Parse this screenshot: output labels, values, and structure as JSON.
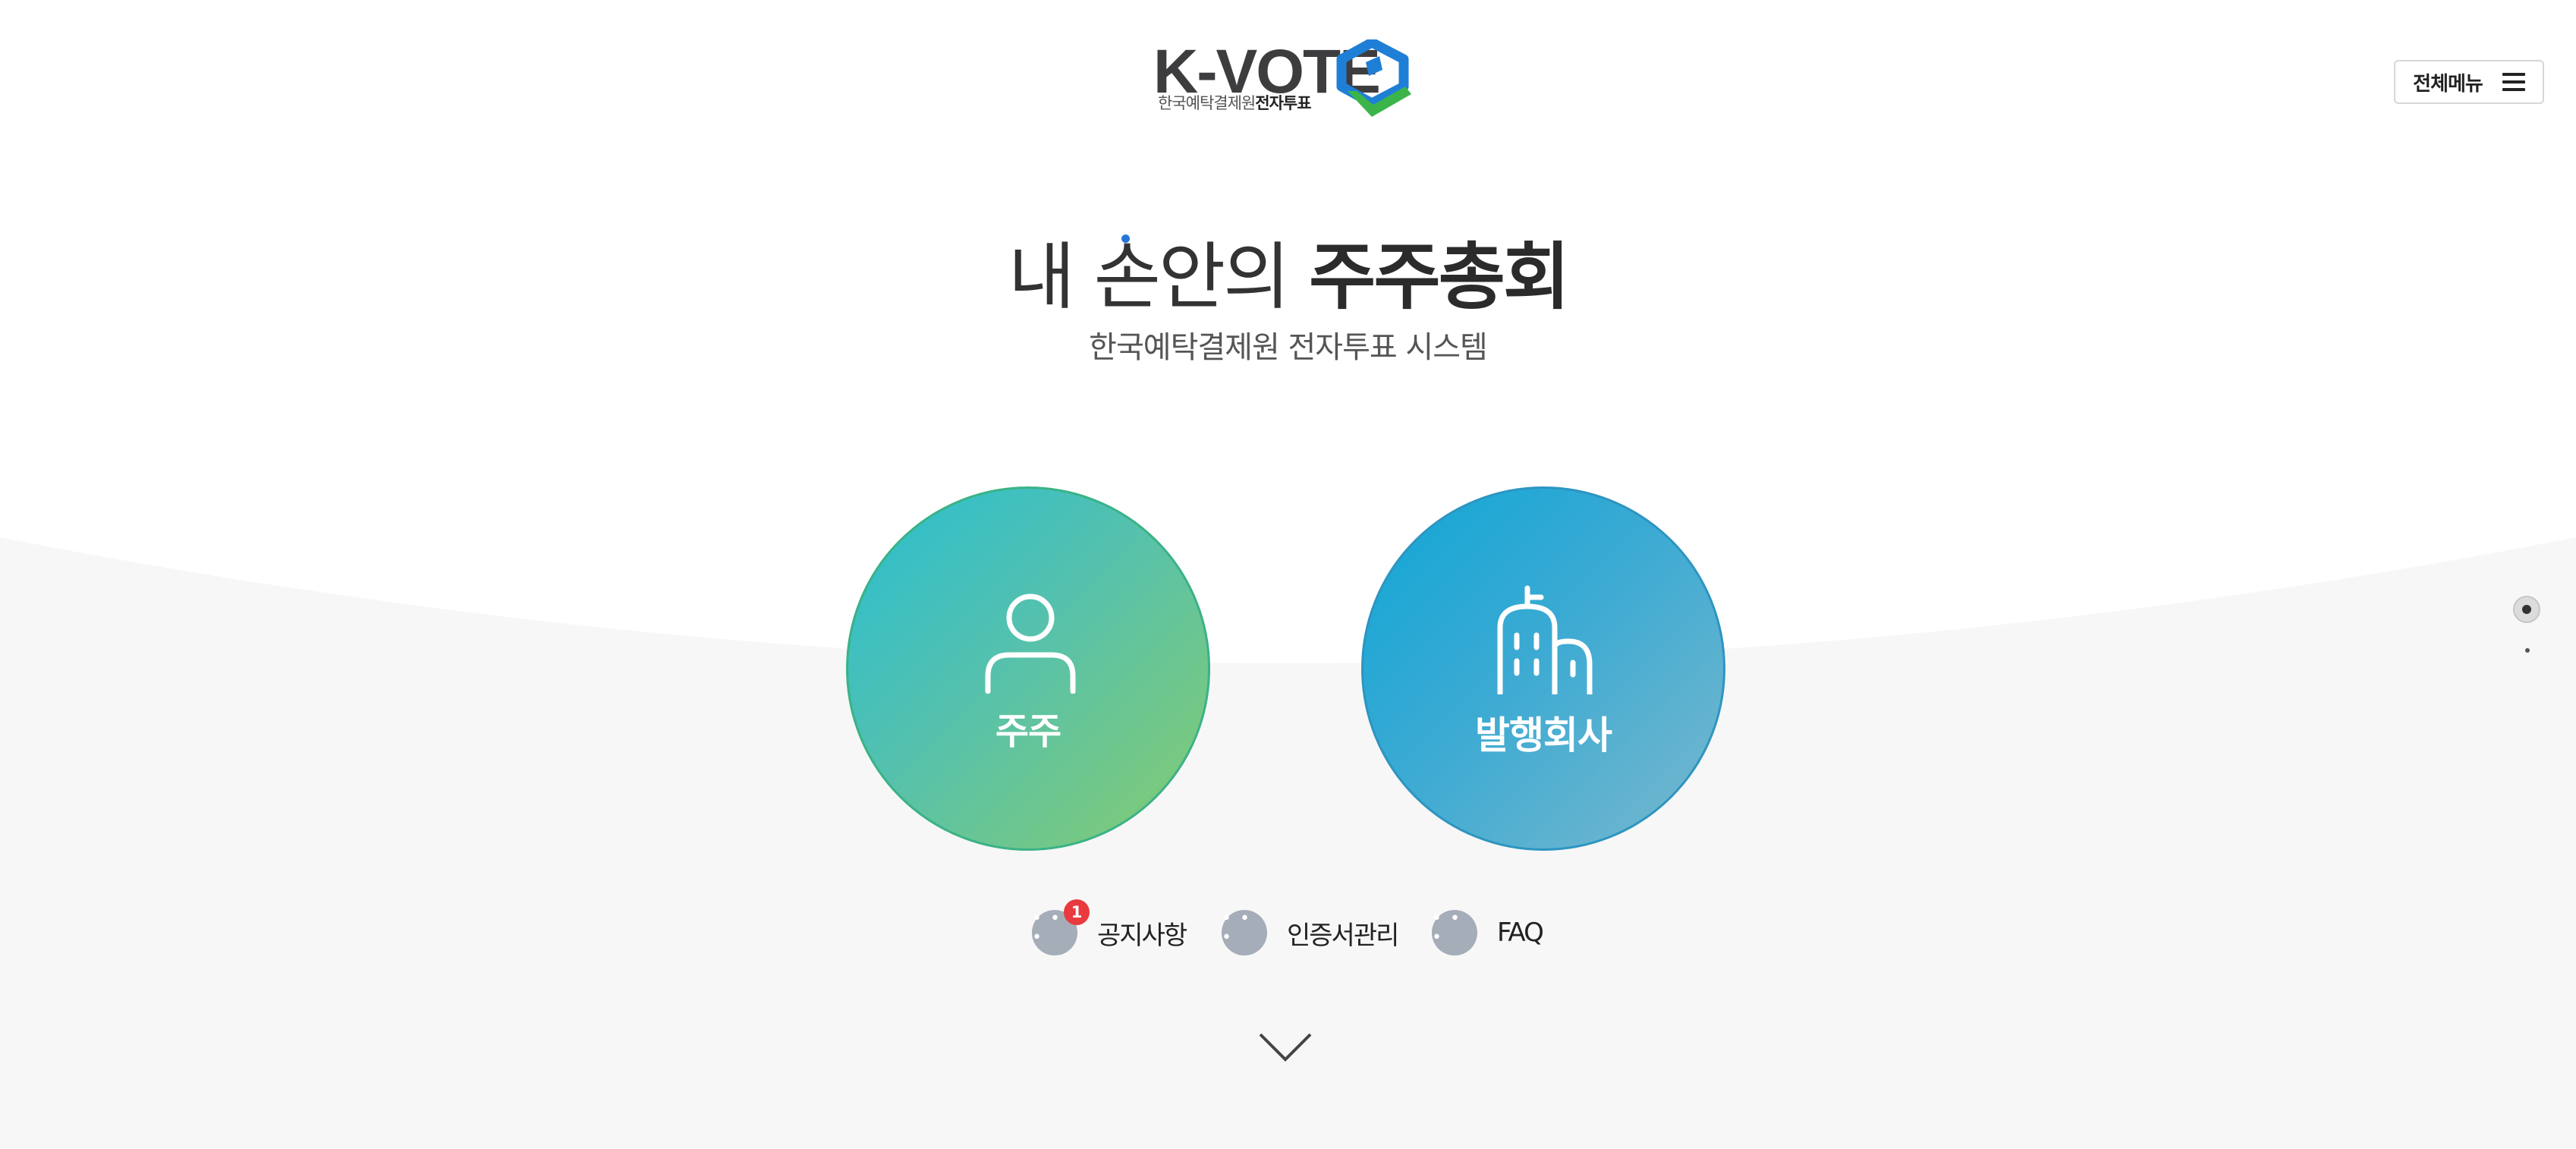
{
  "header": {
    "logo_text": "K-VOTE",
    "logo_sub_normal": "한국예탁결제원",
    "logo_sub_bold": "전자투표",
    "menu_label": "전체메뉴"
  },
  "hero": {
    "title_part1_a": "내 ",
    "title_part1_b": "손",
    "title_part1_c": "안의 ",
    "title_bold": "주주총회",
    "subtitle": "한국예탁결제원 전자투표 시스템"
  },
  "cards": {
    "shareholder": {
      "label": "주주",
      "icon": "person-icon"
    },
    "issuer": {
      "label": "발행회사",
      "icon": "building-icon"
    }
  },
  "quick_links": [
    {
      "label": "공지사항",
      "badge": "1"
    },
    {
      "label": "인증서관리"
    },
    {
      "label": "FAQ"
    }
  ],
  "colors": {
    "shareholder_gradient": [
      "#28bed2",
      "#86cc6f"
    ],
    "issuer_gradient": [
      "#10a6d6",
      "#7ab8cd"
    ],
    "badge": "#e83a3f",
    "logo_blue": "#1f7fd6",
    "logo_green": "#3bb54a"
  },
  "page_indicator": {
    "current": 1,
    "total": 2
  }
}
